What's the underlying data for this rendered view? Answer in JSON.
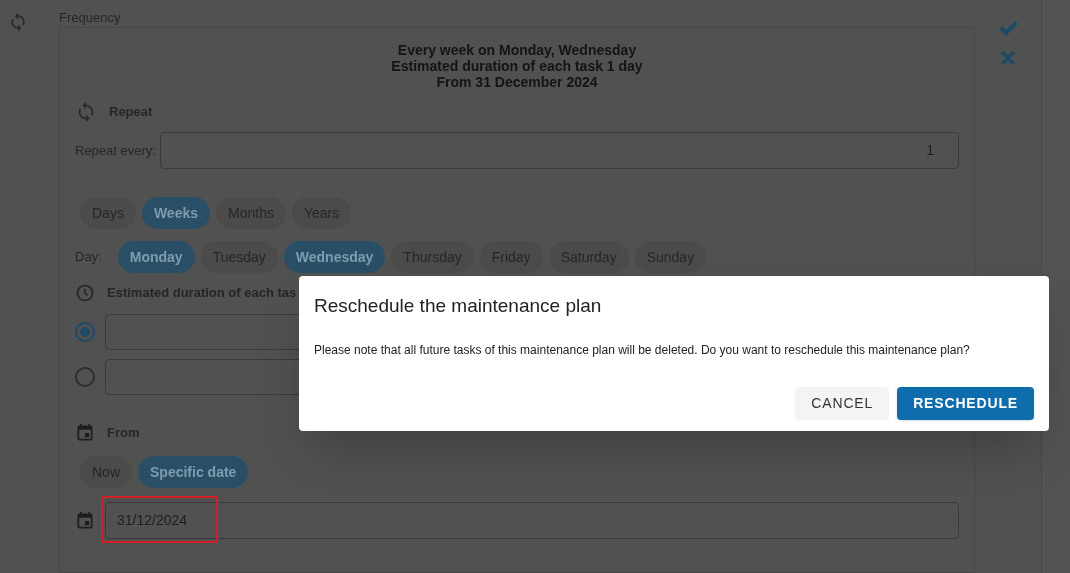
{
  "frequency": {
    "legend": "Frequency",
    "summary": [
      "Every week on Monday, Wednesday",
      "Estimated duration of each task 1 day",
      "From 31 December 2024"
    ],
    "repeat": {
      "title": "Repeat",
      "label": "Repeat every:",
      "value": "1"
    },
    "units": [
      {
        "label": "Days",
        "selected": false
      },
      {
        "label": "Weeks",
        "selected": true
      },
      {
        "label": "Months",
        "selected": false
      },
      {
        "label": "Years",
        "selected": false
      }
    ],
    "day_label": "Day:",
    "days": [
      {
        "label": "Monday",
        "selected": true
      },
      {
        "label": "Tuesday",
        "selected": false
      },
      {
        "label": "Wednesday",
        "selected": true
      },
      {
        "label": "Thursday",
        "selected": false
      },
      {
        "label": "Friday",
        "selected": false
      },
      {
        "label": "Saturday",
        "selected": false
      },
      {
        "label": "Sunday",
        "selected": false
      }
    ],
    "duration": {
      "title": "Estimated duration of each tas",
      "options": [
        {
          "selected": true
        },
        {
          "selected": false
        }
      ]
    },
    "from": {
      "title": "From",
      "options": [
        {
          "label": "Now",
          "selected": false
        },
        {
          "label": "Specific date",
          "selected": true
        }
      ],
      "date": "31/12/2024",
      "highlighted": true
    }
  },
  "dialog": {
    "title": "Reschedule the maintenance plan",
    "message": "Please note that all future tasks of this maintenance plan will be deleted. Do you want to reschedule this maintenance plan?",
    "buttons": [
      {
        "label": "CANCEL",
        "kind": "secondary"
      },
      {
        "label": "RESCHEDULE",
        "kind": "primary"
      }
    ]
  }
}
